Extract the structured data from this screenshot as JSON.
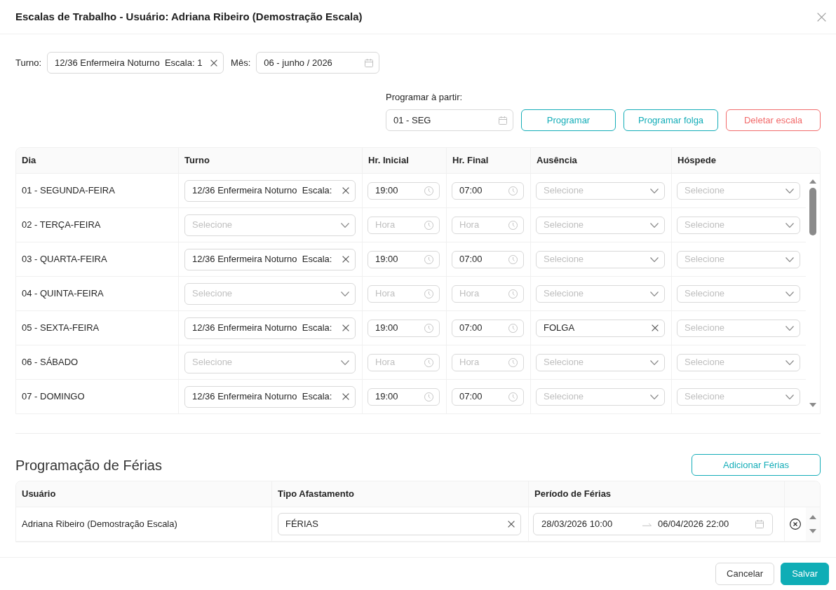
{
  "dialog": {
    "title": "Escalas de Trabalho - Usuário: Adriana Ribeiro (Demostração Escala)"
  },
  "filters": [
    {
      "label": "Turno:",
      "kind": "select",
      "value": "12/36 Enfermeira Noturno  Escala: 1"
    },
    {
      "label": "Mês:",
      "kind": "date",
      "value": "06 - junho / 2026"
    }
  ],
  "schedule_start": {
    "label": "Programar à partir:",
    "value": "01 - SEG"
  },
  "actions": [
    {
      "label": "Programar",
      "kind": "outline"
    },
    {
      "label": "Programar folga",
      "kind": "outline"
    },
    {
      "label": "Deletar escala",
      "kind": "danger"
    }
  ],
  "schedule_table": {
    "columns": [
      "Dia",
      "Turno",
      "Hr. Inicial",
      "Hr. Final",
      "Ausência",
      "Hóspede"
    ],
    "rows": [
      {
        "day": "01 - SEGUNDA-FEIRA",
        "shift": {
          "value": "12/36 Enfermeira Noturno  Escala:"
        },
        "start": {
          "value": "19:00"
        },
        "end": {
          "value": "07:00"
        },
        "absence": {
          "placeholder": "Selecione"
        },
        "guest": {
          "placeholder": "Selecione"
        }
      },
      {
        "day": "02 - TERÇA-FEIRA",
        "shift": {
          "placeholder": "Selecione"
        },
        "start": {
          "placeholder": "Hora"
        },
        "end": {
          "placeholder": "Hora"
        },
        "absence": {
          "placeholder": "Selecione"
        },
        "guest": {
          "placeholder": "Selecione"
        }
      },
      {
        "day": "03 - QUARTA-FEIRA",
        "shift": {
          "value": "12/36 Enfermeira Noturno  Escala:"
        },
        "start": {
          "value": "19:00"
        },
        "end": {
          "value": "07:00"
        },
        "absence": {
          "placeholder": "Selecione"
        },
        "guest": {
          "placeholder": "Selecione"
        }
      },
      {
        "day": "04 - QUINTA-FEIRA",
        "shift": {
          "placeholder": "Selecione"
        },
        "start": {
          "placeholder": "Hora"
        },
        "end": {
          "placeholder": "Hora"
        },
        "absence": {
          "placeholder": "Selecione"
        },
        "guest": {
          "placeholder": "Selecione"
        }
      },
      {
        "day": "05 - SEXTA-FEIRA",
        "shift": {
          "value": "12/36 Enfermeira Noturno  Escala:"
        },
        "start": {
          "value": "19:00"
        },
        "end": {
          "value": "07:00"
        },
        "absence": {
          "value": "FOLGA"
        },
        "guest": {
          "placeholder": "Selecione"
        }
      },
      {
        "day": "06 - SÁBADO",
        "shift": {
          "placeholder": "Selecione"
        },
        "start": {
          "placeholder": "Hora"
        },
        "end": {
          "placeholder": "Hora"
        },
        "absence": {
          "placeholder": "Selecione"
        },
        "guest": {
          "placeholder": "Selecione"
        }
      },
      {
        "day": "07 - DOMINGO",
        "shift": {
          "value": "12/36 Enfermeira Noturno  Escala:"
        },
        "start": {
          "value": "19:00"
        },
        "end": {
          "value": "07:00"
        },
        "absence": {
          "placeholder": "Selecione"
        },
        "guest": {
          "placeholder": "Selecione"
        }
      }
    ]
  },
  "vacation": {
    "title": "Programação de Férias",
    "add_button": "Adicionar Férias",
    "columns": [
      "Usuário",
      "Tipo Afastamento",
      "Período de Férias"
    ],
    "rows": [
      {
        "user": "Adriana Ribeiro (Demostração Escala)",
        "leave_type": {
          "value": "FÉRIAS"
        },
        "period": {
          "start": "28/03/2026 10:00",
          "end": "06/04/2026 22:00"
        }
      }
    ]
  },
  "footer": {
    "buttons": [
      {
        "label": "Cancelar",
        "kind": "default"
      },
      {
        "label": "Salvar",
        "kind": "primary"
      }
    ]
  }
}
